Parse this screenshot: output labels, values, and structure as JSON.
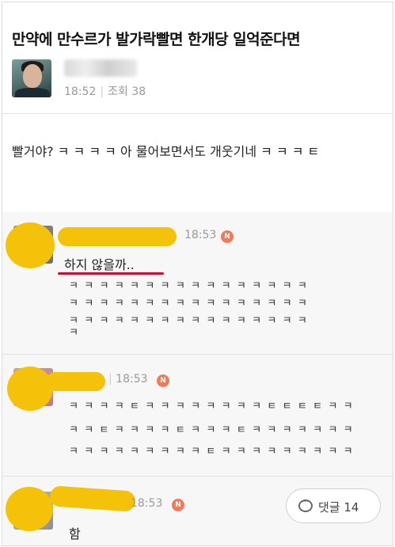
{
  "post": {
    "title": "만약에 만수르가 발가락빨면 한개당 일억준다면",
    "time": "18:52",
    "views": "조회 38",
    "body": "빨거야? ㅋ ㅋ ㅋ ㅋ  아  물어보면서도  개웃기네  ㅋ ㅋ ㅋ ㅌ"
  },
  "comments": [
    {
      "time": "18:53",
      "badge": "N",
      "text": "하지 않을까..",
      "laugh_lines": [
        "ㅋㅋㅋㅋㅋㅋㅋㅋㅋㅋㅋㅋㅋㅋㅋㅋ",
        "ㅋㅋㅋㅋㅋㅋㅋㅋㅋㅋㅋㅋㅋㅋㅋㅋ",
        "ㅋㅋㅋㅋㅋㅋㅋㅋㅋㅋㅋㅋㅋㅋㅋㅋ",
        "ㅋ"
      ]
    },
    {
      "time": "18:53",
      "badge": "N",
      "laugh_lines": [
        "ㅋㅋㅋㅋㅌㅋㅋㅋㅋㅋㅋㅋㅋㅌㅌㅌㅌㅋㅋ",
        "ㅋㅋㅌㅋㅋㅋㅋㅌㅋㅋㅋㅌㅋㅋㅋㅋㅋㅋㅋ",
        "ㅋㅋㅋㅋㅋㅋㅋㅋㅋㅌㅋㅋㅋㅋㅋㅋㅋㅋㅋ"
      ]
    },
    {
      "time": "18:53",
      "badge": "N",
      "text": "함"
    }
  ],
  "reply_button": {
    "label": "댓글 14",
    "icon": "comment-bubble-icon"
  },
  "colors": {
    "highlight": "#f5c20a",
    "underline": "#c8102e",
    "badge": "#f07b5a"
  }
}
